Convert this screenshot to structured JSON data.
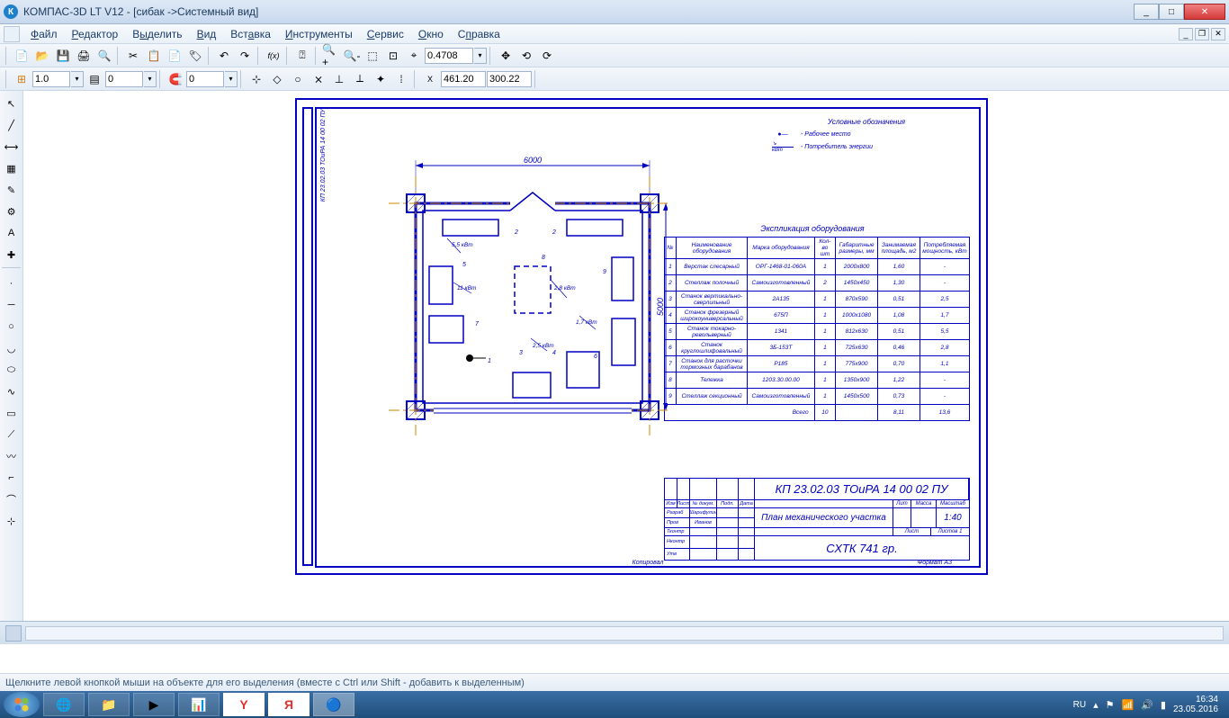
{
  "titlebar": {
    "app_name": "КОМПАС-3D LT V12 - [сибак ->Системный вид]",
    "minimize": "_",
    "maximize": "□",
    "close": "✕"
  },
  "menu": {
    "file": "Файл",
    "editor": "Редактор",
    "select": "Выделить",
    "view": "Вид",
    "insert": "Вставка",
    "tools": "Инструменты",
    "service": "Сервис",
    "window": "Окно",
    "help": "Справка"
  },
  "toolbar1": {
    "zoom_value": "0.4708"
  },
  "toolbar2": {
    "line_width": "1.0",
    "spin_value": "0",
    "step": "0",
    "coord_x": "461.20",
    "coord_y": "300.22"
  },
  "legend": {
    "title": "Условные обозначения",
    "item1_text": "- Рабочее место",
    "item2_label": "кВт",
    "item2_text": "- Потребитель энергии"
  },
  "equip": {
    "title": "Экспликация оборудования",
    "headers": {
      "num": "№",
      "name": "Наименование оборудования",
      "brand": "Марка оборудования",
      "qty": "Кол-во шт",
      "dims": "Габаритные размеры, мм",
      "area": "Занимаемая площадь, м2",
      "power": "Потребляемая мощность, кВт"
    },
    "rows": [
      {
        "n": "1",
        "name": "Верстак слесарный",
        "brand": "ОРГ-1468-01-060А",
        "qty": "1",
        "dims": "2000х800",
        "area": "1,60",
        "power": "-"
      },
      {
        "n": "2",
        "name": "Стеллаж полочный",
        "brand": "Самоизготовленный",
        "qty": "2",
        "dims": "1450х450",
        "area": "1,30",
        "power": "-"
      },
      {
        "n": "3",
        "name": "Станок вертикально-сверлильный",
        "brand": "2А135",
        "qty": "1",
        "dims": "870х590",
        "area": "0,51",
        "power": "2,5"
      },
      {
        "n": "4",
        "name": "Станок фрезерный широкоуниверсальный",
        "brand": "675П",
        "qty": "1",
        "dims": "1000х1080",
        "area": "1,08",
        "power": "1,7"
      },
      {
        "n": "5",
        "name": "Станок токарно-револьверный",
        "brand": "1341",
        "qty": "1",
        "dims": "812х630",
        "area": "0,51",
        "power": "5,5"
      },
      {
        "n": "6",
        "name": "Станок круглошлифовальный",
        "brand": "3Б-153Т",
        "qty": "1",
        "dims": "725х630",
        "area": "0,46",
        "power": "2,8"
      },
      {
        "n": "7",
        "name": "Станок для расточки тормозных барабанов",
        "brand": "Р185",
        "qty": "1",
        "dims": "775х900",
        "area": "0,70",
        "power": "1,1"
      },
      {
        "n": "8",
        "name": "Тележка",
        "brand": "1203.30.00.00",
        "qty": "1",
        "dims": "1350х900",
        "area": "1,22",
        "power": "-"
      },
      {
        "n": "9",
        "name": "Стеллаж секционный",
        "brand": "Самоизготовленный",
        "qty": "1",
        "dims": "1450х500",
        "area": "0,73",
        "power": "-"
      }
    ],
    "total_label": "Всего",
    "total_qty": "10",
    "total_area": "8,11",
    "total_power": "13,6"
  },
  "title_block": {
    "code": "КП 23.02.03 ТОиРА 14 00 02 ПУ",
    "plan_title": "План механического участка",
    "dev_label": "Разраб",
    "check_label": "Пров",
    "name1": "Шарифулин",
    "name2": "Иванов",
    "tcontr": "Тконтр",
    "ncontr": "Нконтр",
    "utv": "Утв",
    "izm": "Изм",
    "list": "Лист",
    "ndok": "№ докум.",
    "podp": "Подп.",
    "data": "Дата",
    "lit": "Лит",
    "massa": "Масса",
    "scale": "Масштаб",
    "scale_val": "1:40",
    "sheet": "Лист",
    "sheets": "Листов   1",
    "org": "СХТК 741 гр."
  },
  "plan": {
    "width_dim": "6000",
    "height_dim": "5000",
    "p1": "1",
    "p2": "2",
    "p3": "3",
    "p4": "4",
    "p5": "5",
    "p6": "6",
    "p7": "7",
    "p8": "8",
    "p9": "9",
    "pw1": "5,5 кВт",
    "pw2": "11 кВт",
    "pw3": "2,8 кВт",
    "pw4": "1,7 кВт",
    "pw5": "2,5 кВт"
  },
  "side_label": "КП 23.02.03 ТОиРА 14 00 02 ПУ",
  "footer": {
    "copied": "Копировал",
    "format": "Формат    А3"
  },
  "status": {
    "hint": "Щелкните левой кнопкой мыши на объекте для его выделения (вместе с Ctrl или Shift - добавить к выделенным)"
  },
  "taskbar": {
    "lang": "RU",
    "time": "16:34",
    "date": "23.05.2016"
  }
}
